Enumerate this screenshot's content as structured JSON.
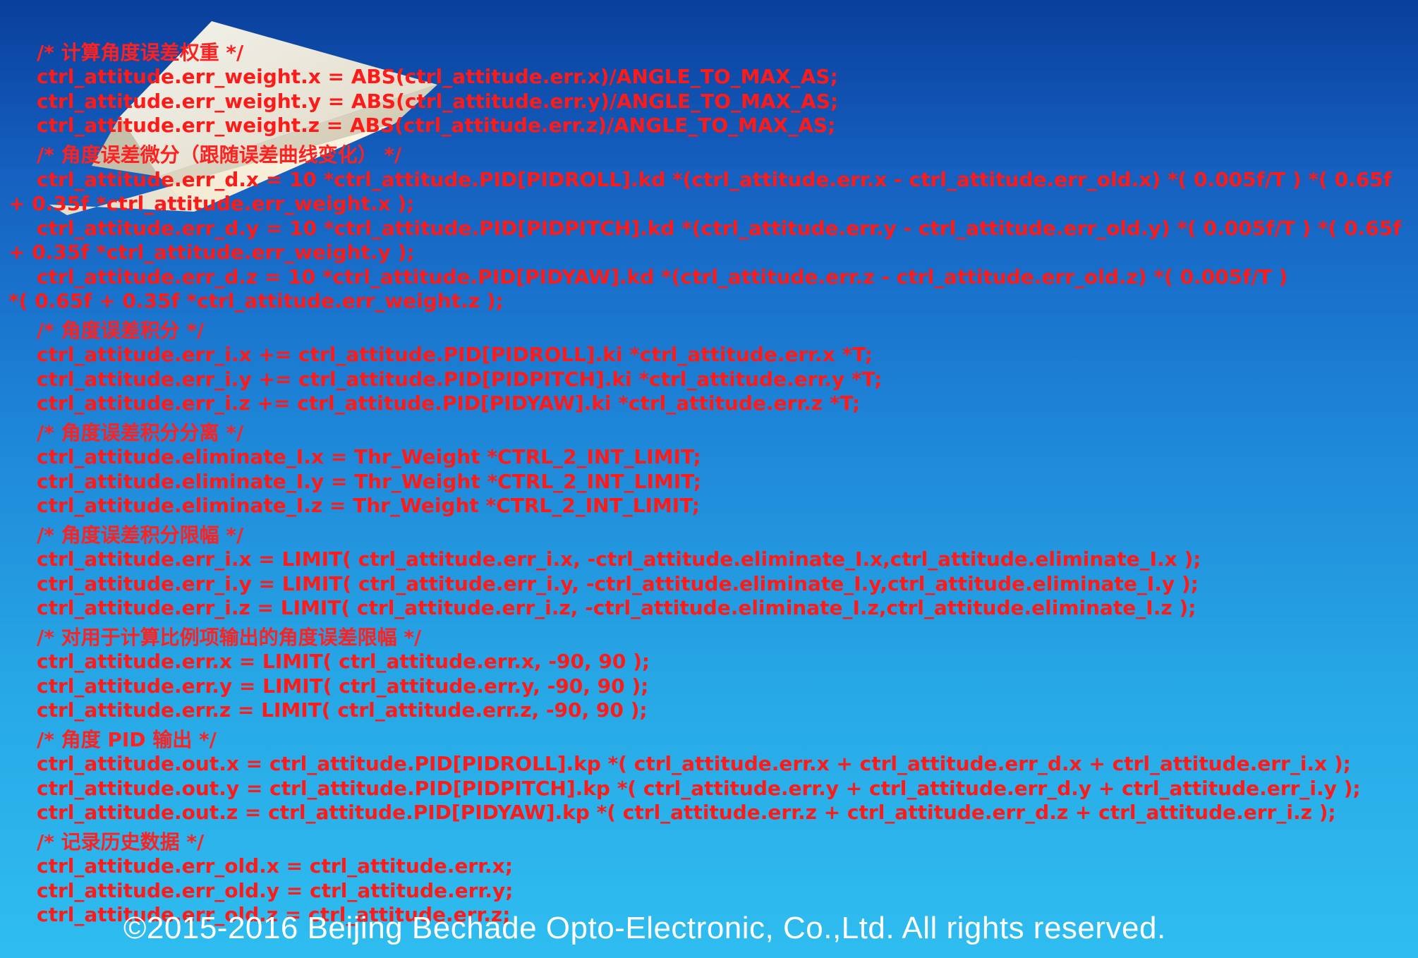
{
  "code_lines": [
    {
      "text": "/*  计算角度误差权重  */",
      "type": "comment"
    },
    {
      "text": "ctrl_attitude.err_weight.x = ABS(ctrl_attitude.err.x)/ANGLE_TO_MAX_AS;",
      "type": "code"
    },
    {
      "text": "ctrl_attitude.err_weight.y = ABS(ctrl_attitude.err.y)/ANGLE_TO_MAX_AS;",
      "type": "code"
    },
    {
      "text": "ctrl_attitude.err_weight.z = ABS(ctrl_attitude.err.z)/ANGLE_TO_MAX_AS;",
      "type": "code"
    },
    {
      "text": "/*  角度误差微分（跟随误差曲线变化）  */",
      "type": "comment"
    },
    {
      "text": "ctrl_attitude.err_d.x = 10 *ctrl_attitude.PID[PIDROLL].kd  *(ctrl_attitude.err.x - ctrl_attitude.err_old.x) *( 0.005f/T ) *( 0.65f",
      "type": "code"
    },
    {
      "text": "+ 0.35f *ctrl_attitude.err_weight.x );",
      "type": "code"
    },
    {
      "text": "ctrl_attitude.err_d.y = 10 *ctrl_attitude.PID[PIDPITCH].kd *(ctrl_attitude.err.y - ctrl_attitude.err_old.y) *( 0.005f/T ) *( 0.65f",
      "type": "code"
    },
    {
      "text": "+ 0.35f *ctrl_attitude.err_weight.y );",
      "type": "code"
    },
    {
      "text": "ctrl_attitude.err_d.z = 10 *ctrl_attitude.PID[PIDYAW].kd         *(ctrl_attitude.err.z - ctrl_attitude.err_old.z) *( 0.005f/T )",
      "type": "code"
    },
    {
      "text": "*( 0.65f + 0.35f *ctrl_attitude.err_weight.z );",
      "type": "code"
    },
    {
      "text": "/*  角度误差积分  */",
      "type": "comment"
    },
    {
      "text": "ctrl_attitude.err_i.x += ctrl_attitude.PID[PIDROLL].ki  *ctrl_attitude.err.x *T;",
      "type": "code"
    },
    {
      "text": "ctrl_attitude.err_i.y += ctrl_attitude.PID[PIDPITCH].ki *ctrl_attitude.err.y *T;",
      "type": "code"
    },
    {
      "text": "ctrl_attitude.err_i.z += ctrl_attitude.PID[PIDYAW].ki   *ctrl_attitude.err.z *T;",
      "type": "code"
    },
    {
      "text": "/*  角度误差积分分离  */",
      "type": "comment"
    },
    {
      "text": "ctrl_attitude.eliminate_I.x = Thr_Weight *CTRL_2_INT_LIMIT;",
      "type": "code"
    },
    {
      "text": "ctrl_attitude.eliminate_I.y = Thr_Weight *CTRL_2_INT_LIMIT;",
      "type": "code"
    },
    {
      "text": "ctrl_attitude.eliminate_I.z = Thr_Weight *CTRL_2_INT_LIMIT;",
      "type": "code"
    },
    {
      "text": "/*  角度误差积分限幅  */",
      "type": "comment"
    },
    {
      "text": "ctrl_attitude.err_i.x = LIMIT( ctrl_attitude.err_i.x, -ctrl_attitude.eliminate_I.x,ctrl_attitude.eliminate_I.x );",
      "type": "code"
    },
    {
      "text": "ctrl_attitude.err_i.y = LIMIT( ctrl_attitude.err_i.y, -ctrl_attitude.eliminate_I.y,ctrl_attitude.eliminate_I.y );",
      "type": "code"
    },
    {
      "text": "ctrl_attitude.err_i.z = LIMIT( ctrl_attitude.err_i.z, -ctrl_attitude.eliminate_I.z,ctrl_attitude.eliminate_I.z );",
      "type": "code"
    },
    {
      "text": "/*  对用于计算比例项输出的角度误差限幅  */",
      "type": "comment"
    },
    {
      "text": "ctrl_attitude.err.x = LIMIT( ctrl_attitude.err.x, -90, 90 );",
      "type": "code"
    },
    {
      "text": "ctrl_attitude.err.y = LIMIT( ctrl_attitude.err.y, -90, 90 );",
      "type": "code"
    },
    {
      "text": "ctrl_attitude.err.z = LIMIT( ctrl_attitude.err.z, -90, 90 );",
      "type": "code"
    },
    {
      "text": "/*  角度 PID 输出  */",
      "type": "comment"
    },
    {
      "text": "ctrl_attitude.out.x = ctrl_attitude.PID[PIDROLL].kp  *( ctrl_attitude.err.x + ctrl_attitude.err_d.x + ctrl_attitude.err_i.x );",
      "type": "code"
    },
    {
      "text": "ctrl_attitude.out.y = ctrl_attitude.PID[PIDPITCH].kp *( ctrl_attitude.err.y + ctrl_attitude.err_d.y + ctrl_attitude.err_i.y );",
      "type": "code"
    },
    {
      "text": "ctrl_attitude.out.z = ctrl_attitude.PID[PIDYAW].kp   *( ctrl_attitude.err.z + ctrl_attitude.err_d.z + ctrl_attitude.err_i.z );",
      "type": "code"
    },
    {
      "text": "/*  记录历史数据  */",
      "type": "comment"
    },
    {
      "text": "ctrl_attitude.err_old.x = ctrl_attitude.err.x;",
      "type": "code"
    },
    {
      "text": "ctrl_attitude.err_old.y = ctrl_attitude.err.y;",
      "type": "code"
    },
    {
      "text": "ctrl_attitude.err_old.z = ctrl_attitude.err.z;",
      "type": "code"
    }
  ],
  "footer": {
    "copyright": "©2015-2016 Beijing Bechade Opto-Electronic, Co.,Ltd. All rights reserved."
  },
  "colors": {
    "code_text": "#ff1a1a",
    "footer_text": "#ffffff",
    "background_top": "#0a3f9c",
    "background_bottom": "#2fbdf0"
  },
  "decoration": {
    "icon": "paper-plane-icon"
  }
}
